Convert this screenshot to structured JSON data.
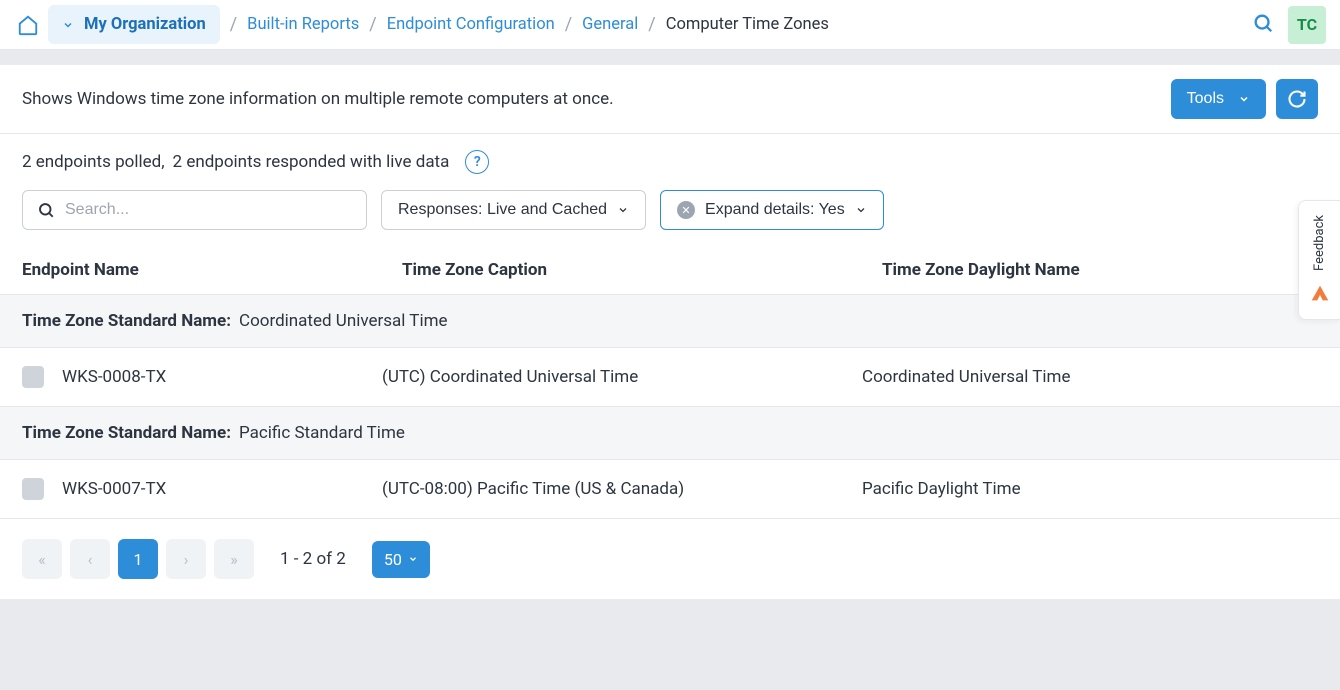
{
  "breadcrumb": {
    "org": "My Organization",
    "items": [
      "Built-in Reports",
      "Endpoint Configuration",
      "General"
    ],
    "current": "Computer Time Zones"
  },
  "avatar": "TC",
  "description": "Shows Windows time zone information on multiple remote computers at once.",
  "tools_label": "Tools",
  "status": {
    "polled": "2 endpoints polled,",
    "responded": "2 endpoints responded with live data"
  },
  "search_placeholder": "Search...",
  "filters": {
    "responses": "Responses: Live and Cached",
    "expand": "Expand details: Yes"
  },
  "columns": {
    "c1": "Endpoint Name",
    "c2": "Time Zone Caption",
    "c3": "Time Zone Daylight Name"
  },
  "group_label": "Time Zone Standard Name:",
  "groups": [
    {
      "name": "Coordinated Universal Time",
      "rows": [
        {
          "endpoint": "WKS-0008-TX",
          "caption": "(UTC) Coordinated Universal Time",
          "daylight": "Coordinated Universal Time"
        }
      ]
    },
    {
      "name": "Pacific Standard Time",
      "rows": [
        {
          "endpoint": "WKS-0007-TX",
          "caption": "(UTC-08:00) Pacific Time (US & Canada)",
          "daylight": "Pacific Daylight Time"
        }
      ]
    }
  ],
  "pagination": {
    "page": "1",
    "range": "1 - 2 of 2",
    "size": "50"
  },
  "feedback": "Feedback"
}
